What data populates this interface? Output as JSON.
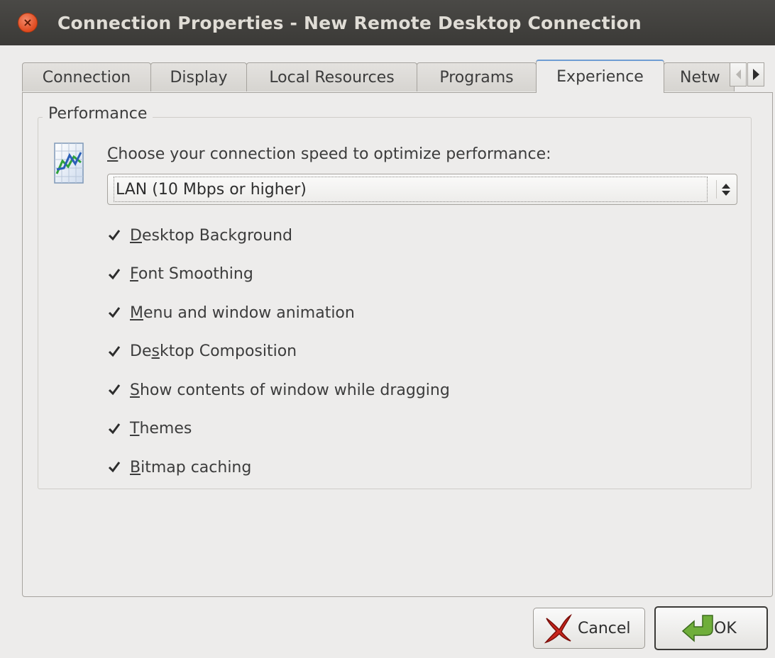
{
  "window": {
    "title": "Connection Properties - New Remote Desktop Connection"
  },
  "tabs": [
    {
      "label": "Connection",
      "active": false
    },
    {
      "label": "Display",
      "active": false
    },
    {
      "label": "Local Resources",
      "active": false
    },
    {
      "label": "Programs",
      "active": false
    },
    {
      "label": "Experience",
      "active": true
    },
    {
      "label": "Netw",
      "active": false
    }
  ],
  "performance": {
    "legend": "Performance",
    "speed_label_first": "C",
    "speed_label_rest": "hoose your connection speed to optimize performance:",
    "speed_value": "LAN (10 Mbps or higher)",
    "options": [
      {
        "mnemonic": "D",
        "rest": "esktop Background",
        "checked": true
      },
      {
        "mnemonic": "F",
        "rest": "ont Smoothing",
        "checked": true
      },
      {
        "mnemonic": "M",
        "rest": "enu and window animation",
        "checked": true
      },
      {
        "mnemonic": "",
        "pre": "De",
        "mid": "s",
        "post": "ktop Composition",
        "checked": true
      },
      {
        "mnemonic": "S",
        "rest": "how contents of window while dragging",
        "checked": true
      },
      {
        "mnemonic": "T",
        "rest": "hemes",
        "checked": true
      },
      {
        "mnemonic": "B",
        "rest": "itmap caching",
        "checked": true
      }
    ]
  },
  "buttons": {
    "cancel_label": "Cancel",
    "ok_label": "OK"
  },
  "colors": {
    "titlebar": "#3b3a37",
    "close_button": "#df4a1f",
    "window_bg": "#edeceb",
    "active_tab_accent": "#6f9dd3"
  },
  "icons": {
    "close": "close-icon",
    "performance": "performance-chart-icon",
    "checkbox": "checkmark-icon",
    "cancel": "red-x-icon",
    "ok": "green-arrow-icon"
  }
}
